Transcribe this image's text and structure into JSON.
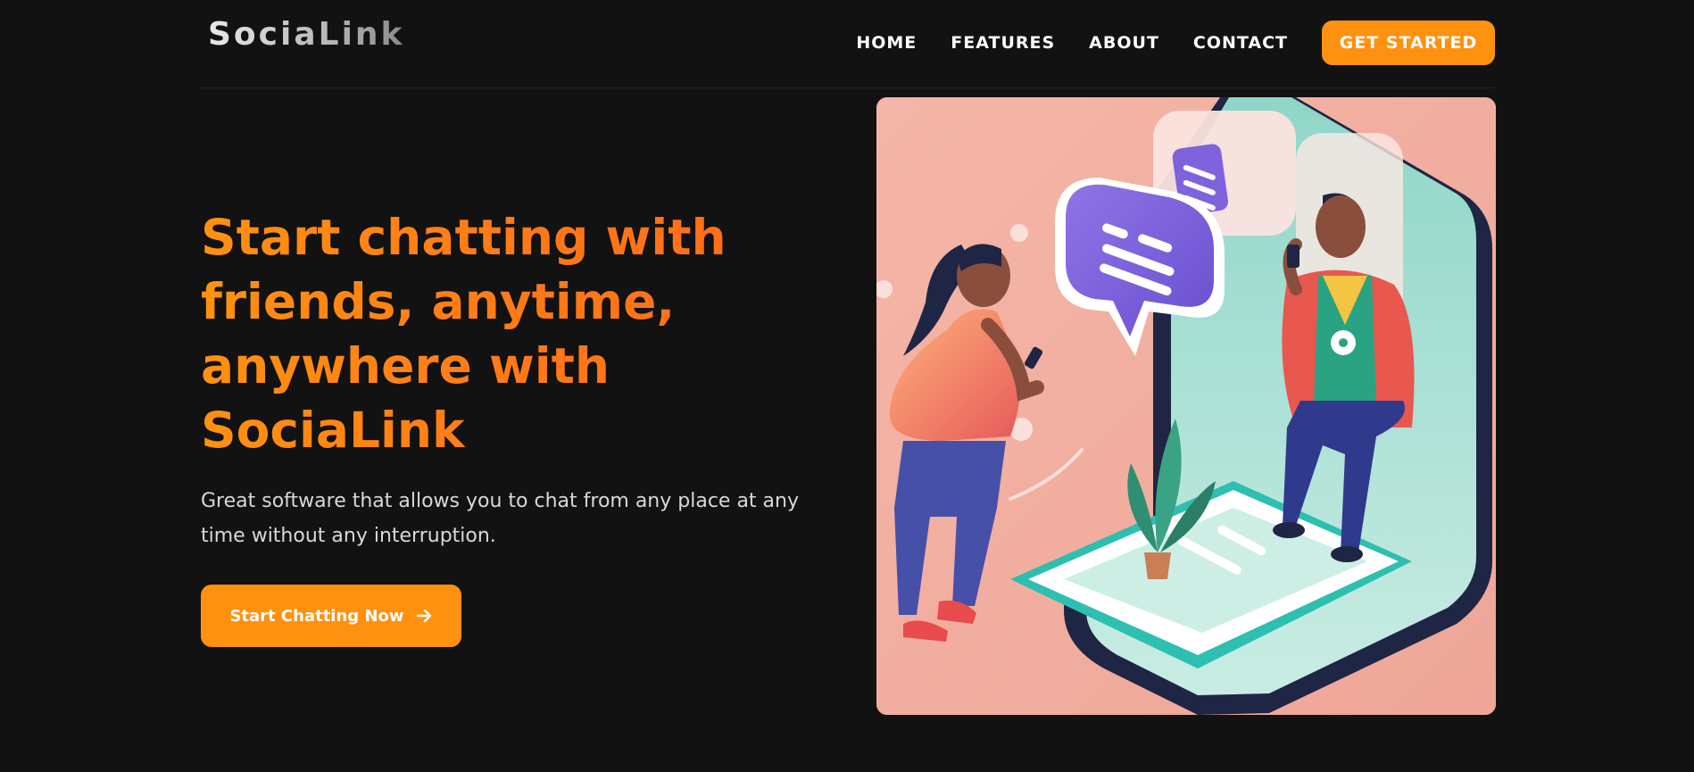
{
  "brand": {
    "name": "SociaLink"
  },
  "nav": {
    "items": [
      {
        "label": "HOME"
      },
      {
        "label": "FEATURES"
      },
      {
        "label": "ABOUT"
      },
      {
        "label": "CONTACT"
      }
    ],
    "cta_label": "GET STARTED"
  },
  "hero": {
    "title": "Start chatting with friends, anytime, anywhere with SociaLink",
    "subtitle": "Great software that allows you to chat from any place at any time without any interruption.",
    "button_label": "Start Chatting Now",
    "button_icon": "arrow-right-icon",
    "illustration": "two-people-chatting-with-phones-illustration"
  },
  "colors": {
    "background": "#121212",
    "accent": "#ff9110",
    "accent_dark": "#ff6b1a",
    "text": "#ffffff",
    "muted_text": "#d8d8d8"
  }
}
